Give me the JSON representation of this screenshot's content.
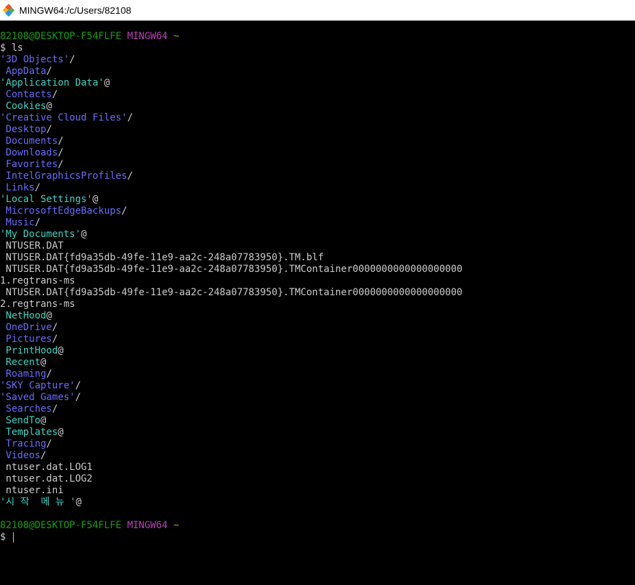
{
  "window": {
    "title": "MINGW64:/c/Users/82108"
  },
  "colors": {
    "user": "#13a10e",
    "host": "#bc3fbc",
    "directory": "#6b6bff",
    "symlink": "#3bd6c6",
    "text": "#cccccc",
    "background": "#000000"
  },
  "prompt": {
    "user": "82108@DESKTOP-F54FLFE",
    "host": "MINGW64",
    "path": "~"
  },
  "command": "$ ls",
  "entries": [
    {
      "text": "'3D Objects'",
      "kind": "dir",
      "suffix": "/"
    },
    {
      "text": " AppData",
      "kind": "dir",
      "suffix": "/"
    },
    {
      "text": "'Application Data'",
      "kind": "link",
      "suffix": "@"
    },
    {
      "text": " Contacts",
      "kind": "dir",
      "suffix": "/"
    },
    {
      "text": " Cookies",
      "kind": "link",
      "suffix": "@"
    },
    {
      "text": "'Creative Cloud Files'",
      "kind": "dir",
      "suffix": "/"
    },
    {
      "text": " Desktop",
      "kind": "dir",
      "suffix": "/"
    },
    {
      "text": " Documents",
      "kind": "dir",
      "suffix": "/"
    },
    {
      "text": " Downloads",
      "kind": "dir",
      "suffix": "/"
    },
    {
      "text": " Favorites",
      "kind": "dir",
      "suffix": "/"
    },
    {
      "text": " IntelGraphicsProfiles",
      "kind": "dir",
      "suffix": "/"
    },
    {
      "text": " Links",
      "kind": "dir",
      "suffix": "/"
    },
    {
      "text": "'Local Settings'",
      "kind": "link",
      "suffix": "@"
    },
    {
      "text": " MicrosoftEdgeBackups",
      "kind": "dir",
      "suffix": "/"
    },
    {
      "text": " Music",
      "kind": "dir",
      "suffix": "/"
    },
    {
      "text": "'My Documents'",
      "kind": "link",
      "suffix": "@"
    },
    {
      "text": " NTUSER.DAT",
      "kind": "plain",
      "suffix": ""
    },
    {
      "text": " NTUSER.DAT{fd9a35db-49fe-11e9-aa2c-248a07783950}.TM.blf",
      "kind": "plain",
      "suffix": ""
    },
    {
      "text": " NTUSER.DAT{fd9a35db-49fe-11e9-aa2c-248a07783950}.TMContainer0000000000000000000",
      "kind": "plain",
      "suffix": ""
    },
    {
      "text": "1.regtrans-ms",
      "kind": "plain",
      "suffix": ""
    },
    {
      "text": " NTUSER.DAT{fd9a35db-49fe-11e9-aa2c-248a07783950}.TMContainer0000000000000000000",
      "kind": "plain",
      "suffix": ""
    },
    {
      "text": "2.regtrans-ms",
      "kind": "plain",
      "suffix": ""
    },
    {
      "text": " NetHood",
      "kind": "link",
      "suffix": "@"
    },
    {
      "text": " OneDrive",
      "kind": "dir",
      "suffix": "/"
    },
    {
      "text": " Pictures",
      "kind": "dir",
      "suffix": "/"
    },
    {
      "text": " PrintHood",
      "kind": "link",
      "suffix": "@"
    },
    {
      "text": " Recent",
      "kind": "link",
      "suffix": "@"
    },
    {
      "text": " Roaming",
      "kind": "dir",
      "suffix": "/"
    },
    {
      "text": "'SKY Capture'",
      "kind": "dir",
      "suffix": "/"
    },
    {
      "text": "'Saved Games'",
      "kind": "dir",
      "suffix": "/"
    },
    {
      "text": " Searches",
      "kind": "dir",
      "suffix": "/"
    },
    {
      "text": " SendTo",
      "kind": "link",
      "suffix": "@"
    },
    {
      "text": " Templates",
      "kind": "link",
      "suffix": "@"
    },
    {
      "text": " Tracing",
      "kind": "dir",
      "suffix": "/"
    },
    {
      "text": " Videos",
      "kind": "dir",
      "suffix": "/"
    },
    {
      "text": " ntuser.dat.LOG1",
      "kind": "plain",
      "suffix": ""
    },
    {
      "text": " ntuser.dat.LOG2",
      "kind": "plain",
      "suffix": ""
    },
    {
      "text": " ntuser.ini",
      "kind": "plain",
      "suffix": ""
    },
    {
      "text": "'시 작  메 뉴 '",
      "kind": "link",
      "suffix": "@"
    }
  ],
  "input_prompt": "$ "
}
